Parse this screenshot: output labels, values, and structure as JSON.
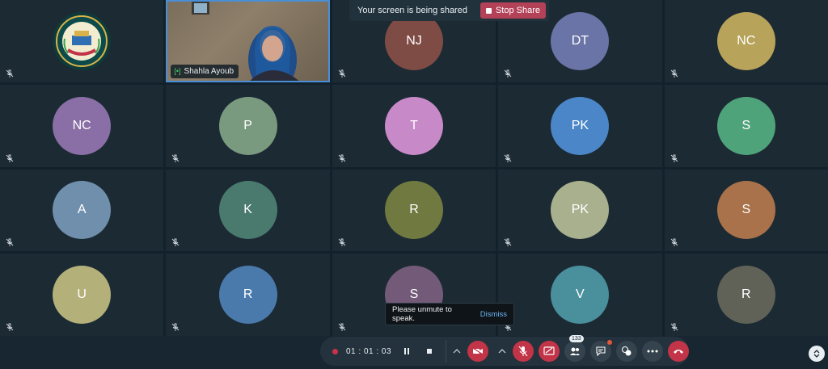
{
  "share_banner": {
    "message": "Your screen is being shared",
    "stop_label": "Stop Share"
  },
  "video_participant": {
    "name": "Shahla Ayoub"
  },
  "participants": [
    {
      "initials": "NJ",
      "color": "#7e4c45"
    },
    {
      "initials": "DT",
      "color": "#6a74a6"
    },
    {
      "initials": "NC",
      "color": "#b7a35a"
    },
    {
      "initials": "NC",
      "color": "#8a6ea6"
    },
    {
      "initials": "P",
      "color": "#7a9a80"
    },
    {
      "initials": "T",
      "color": "#c889c8"
    },
    {
      "initials": "PK",
      "color": "#4a86c8"
    },
    {
      "initials": "S",
      "color": "#4fa37a"
    },
    {
      "initials": "A",
      "color": "#6f8fac"
    },
    {
      "initials": "K",
      "color": "#4a7a6e"
    },
    {
      "initials": "R",
      "color": "#707a40"
    },
    {
      "initials": "PK",
      "color": "#a9b08e"
    },
    {
      "initials": "S",
      "color": "#a9724a"
    },
    {
      "initials": "U",
      "color": "#b3b07a"
    },
    {
      "initials": "R",
      "color": "#4a7aac"
    },
    {
      "initials": "S",
      "color": "#735a78"
    },
    {
      "initials": "V",
      "color": "#4a8f9c"
    },
    {
      "initials": "R",
      "color": "#606258"
    }
  ],
  "toast": {
    "message": "Please unmute to speak.",
    "action": "Dismiss"
  },
  "toolbar": {
    "recording_time": "01 : 01 : 03",
    "participants_count": "133",
    "icons": {
      "record": "record-dot-icon",
      "pause": "pause-icon",
      "stop": "stop-icon",
      "video": "video-off-icon",
      "mic": "mic-off-icon",
      "share": "share-screen-icon",
      "participants": "participants-icon",
      "chat": "chat-icon",
      "reactions": "reactions-icon",
      "more": "more-icon",
      "leave": "leave-call-icon"
    }
  }
}
